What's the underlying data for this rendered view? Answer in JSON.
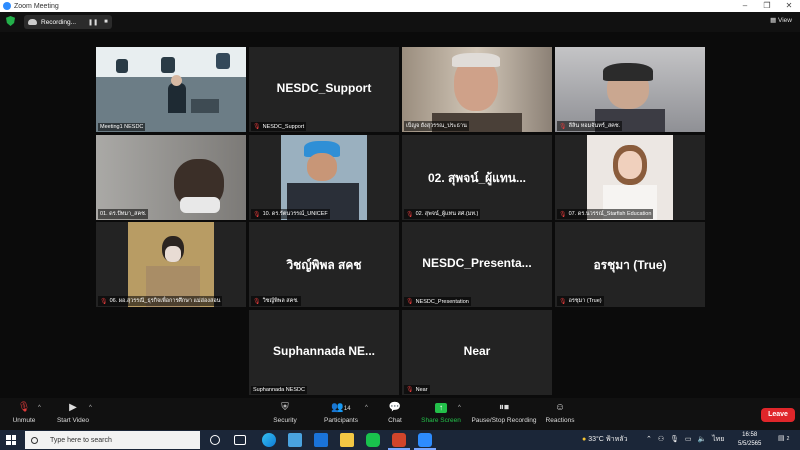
{
  "window": {
    "title": "Zoom Meeting",
    "minimize": "–",
    "maximize": "❐",
    "close": "✕"
  },
  "recording": {
    "label": "Recording...",
    "pause": "❚❚",
    "stop": "■"
  },
  "view": {
    "label": "View"
  },
  "tiles": [
    {
      "name": "Meeting1 NESDC",
      "big": ""
    },
    {
      "name": "NESDC_Support",
      "big": "NESDC_Support"
    },
    {
      "name": "เบ็ญจ ยังสุวรรณ_ประธาน",
      "big": ""
    },
    {
      "name": "ลีลิน หอมจันทร์_สคช.",
      "big": ""
    },
    {
      "name": "01. ดร.ปัทมา_สคช.",
      "big": ""
    },
    {
      "name": "10. ดร.รัตนวรรณ์_UNICEF",
      "big": ""
    },
    {
      "name": "02. สุพจน์_ผู้แทน สศ.(มท.)",
      "big": "02. สุพจน์_ผู้แทน..."
    },
    {
      "name": "07. ดร.นวรรณ์_Starfish Education",
      "big": ""
    },
    {
      "name": "06. ผอ.สุวรรณี_ธุรกิจเพื่อการศึกษา แม่ฮ่องสอน",
      "big": ""
    },
    {
      "name": "วิชญ์พิพล สคช.",
      "big": "วิชญ์พิพล สคช"
    },
    {
      "name": "NESDC_Presentation",
      "big": "NESDC_Presenta..."
    },
    {
      "name": "อรชุมา (True)",
      "big": "อรชุมา (True)"
    },
    {
      "name": "Suphannada NESDC",
      "big": "Suphannada NE..."
    },
    {
      "name": "Near",
      "big": "Near"
    }
  ],
  "controls": {
    "unmute": "Unmute",
    "start_video": "Start Video",
    "security": "Security",
    "participants": "Participants",
    "participants_count": "14",
    "chat": "Chat",
    "share_screen": "Share Screen",
    "pause_stop_recording": "Pause/Stop Recording",
    "reactions": "Reactions",
    "leave": "Leave"
  },
  "taskbar": {
    "search_placeholder": "Type here to search",
    "weather": "33°C ฟ้าหลัว",
    "language": "ไทย",
    "time": "16:58",
    "date": "5/5/2565",
    "notification_count": "2"
  },
  "colors": {
    "accent_active_speaker": "#c9d947",
    "leave": "#e0262a",
    "share": "#23c04a",
    "taskbar": "#1b2638"
  }
}
